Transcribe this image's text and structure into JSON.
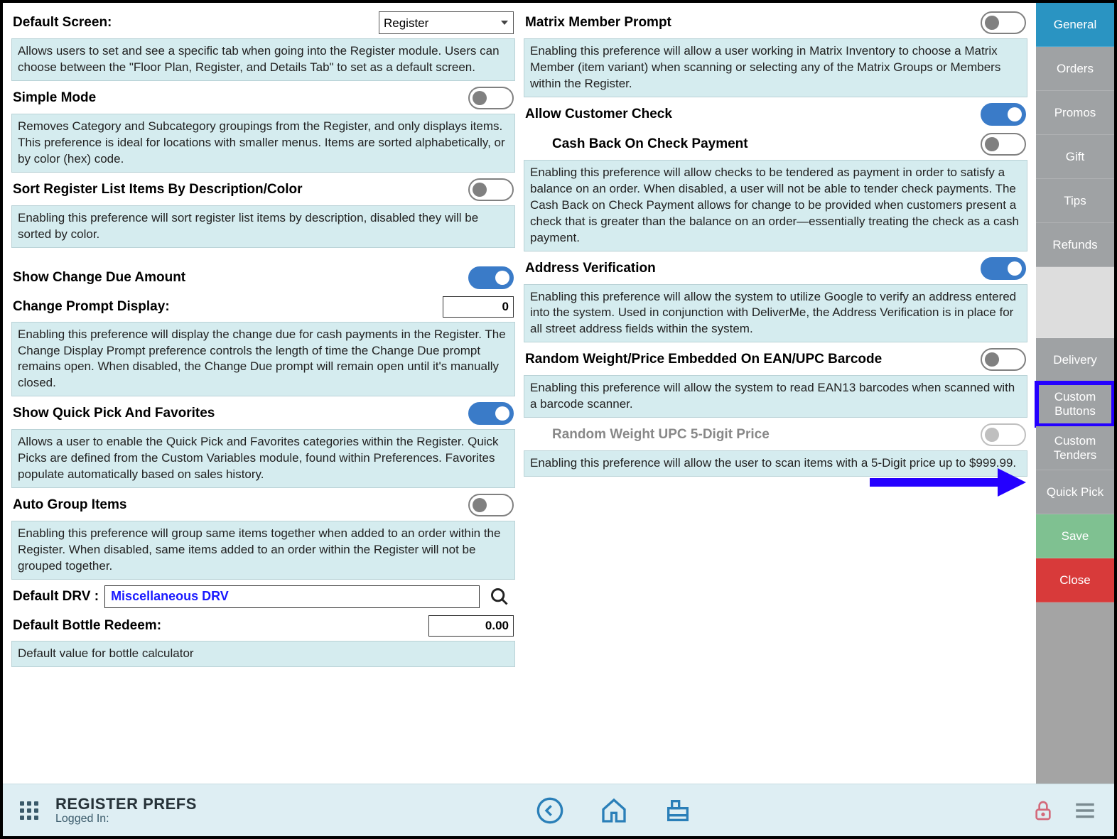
{
  "left": {
    "default_screen": {
      "label": "Default Screen:",
      "value": "Register",
      "desc": "Allows users to set and see a specific tab when going into the Register module. Users can choose between the \"Floor Plan, Register, and Details Tab\" to set as a default screen."
    },
    "simple_mode": {
      "label": "Simple Mode",
      "on": false,
      "desc": "Removes Category and Subcategory groupings from the Register, and only displays items. This preference is ideal for locations with smaller menus. Items are sorted alphabetically, or by color (hex) code."
    },
    "sort_register": {
      "label": "Sort Register List Items By Description/Color",
      "on": false,
      "desc": "Enabling this preference will sort register list items by description, disabled they will be sorted by color."
    },
    "show_change": {
      "label": "Show Change Due Amount",
      "on": true
    },
    "change_prompt": {
      "label": "Change Prompt Display:",
      "value": "0",
      "desc": "Enabling this preference will display the change due for cash payments in the Register. The Change Display Prompt preference controls the length of time the Change Due prompt remains open. When disabled, the Change Due prompt will remain open until it's manually closed."
    },
    "quick_pick": {
      "label": "Show Quick Pick And Favorites",
      "on": true,
      "desc": "Allows a user to enable the Quick Pick and Favorites categories within the Register. Quick Picks are defined from the Custom Variables module, found within Preferences. Favorites populate automatically based on sales history."
    },
    "auto_group": {
      "label": "Auto Group Items",
      "on": false,
      "desc": "Enabling this preference will group same items together when added to an order within the Register. When disabled, same items added to an order within the Register will not be grouped together."
    },
    "default_drv": {
      "label": "Default DRV :",
      "value": "Miscellaneous DRV"
    },
    "bottle_redeem": {
      "label": "Default Bottle Redeem:",
      "value": "0.00",
      "desc": "Default value for bottle calculator"
    }
  },
  "right": {
    "matrix_prompt": {
      "label": "Matrix Member Prompt",
      "on": false,
      "desc": "Enabling this preference will allow a user working in Matrix Inventory to choose a Matrix Member (item variant) when scanning or selecting any of the Matrix Groups or Members within the Register."
    },
    "allow_check": {
      "label": "Allow Customer Check",
      "on": true
    },
    "cash_back": {
      "label": "Cash Back On Check Payment",
      "on": false,
      "desc": "Enabling this preference will allow checks to be tendered as payment in order to satisfy a balance on an order. When disabled, a user will not be able to tender check payments. The Cash Back on Check Payment allows for change to be provided when customers present a check that is greater than the balance on an order—essentially treating the check as a cash payment."
    },
    "address_verify": {
      "label": "Address Verification",
      "on": true,
      "desc": "Enabling this preference will allow the system to utilize Google to verify an address entered into the system. Used in conjunction with DeliverMe, the Address Verification is in place for all street address fields within the system."
    },
    "random_weight": {
      "label": "Random Weight/Price Embedded On EAN/UPC Barcode",
      "on": false,
      "desc": "Enabling this preference will allow the system to read EAN13 barcodes when scanned with a barcode scanner."
    },
    "random_upc5": {
      "label": "Random Weight UPC 5-Digit Price",
      "on": false,
      "disabled": true,
      "desc": "Enabling this preference will allow the user to scan items with a 5-Digit price up to $999.99."
    }
  },
  "sidebar": {
    "items": [
      {
        "label": "General",
        "active": true
      },
      {
        "label": "Orders"
      },
      {
        "label": "Promos"
      },
      {
        "label": "Gift"
      },
      {
        "label": "Tips"
      },
      {
        "label": "Refunds"
      },
      {
        "spacer": true
      },
      {
        "label": "Delivery"
      },
      {
        "label": "Custom Buttons",
        "highlight": true
      },
      {
        "label": "Custom Tenders"
      },
      {
        "label": "Quick Pick"
      },
      {
        "label": "Save",
        "save": true
      },
      {
        "label": "Close",
        "close": true
      }
    ]
  },
  "footer": {
    "title": "REGISTER PREFS",
    "sub": "Logged In:"
  }
}
